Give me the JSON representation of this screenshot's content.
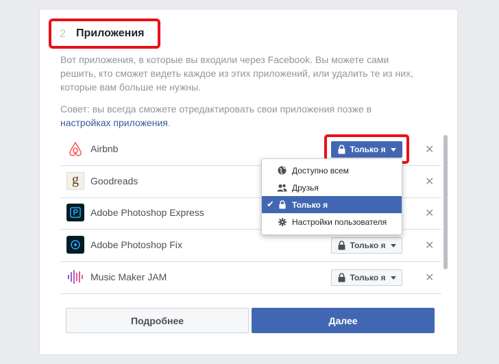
{
  "section": {
    "step": "2",
    "title": "Приложения",
    "description": "Вот приложения, в которые вы входили через Facebook. Вы можете сами решить, кто сможет видеть каждое из этих приложений, или удалить те из них, которые вам больше не нужны.",
    "tip_prefix": "Совет: вы всегда сможете отредактировать свои приложения позже в ",
    "tip_link": "настройках приложения",
    "tip_suffix": "."
  },
  "apps": [
    {
      "name": "Airbnb",
      "privacy": "Только я",
      "icon": "airbnb-logo"
    },
    {
      "name": "Goodreads",
      "privacy": "Только я",
      "icon": "goodreads-logo"
    },
    {
      "name": "Adobe Photoshop Express",
      "privacy": "Только я",
      "icon": "photoshop-express-logo"
    },
    {
      "name": "Adobe Photoshop Fix",
      "privacy": "Только я",
      "icon": "photoshop-fix-logo"
    },
    {
      "name": "Music Maker JAM",
      "privacy": "Только я",
      "icon": "music-maker-jam-logo"
    }
  ],
  "remove_glyph": "✕",
  "dropdown": {
    "options": [
      {
        "label": "Доступно всем",
        "icon": "globe-icon"
      },
      {
        "label": "Друзья",
        "icon": "friends-icon"
      },
      {
        "label": "Только я",
        "icon": "lock-icon",
        "selected": true
      },
      {
        "label": "Настройки пользователя",
        "icon": "gear-icon"
      }
    ]
  },
  "buttons": {
    "more": "Подробнее",
    "next": "Далее"
  },
  "colors": {
    "accent": "#4267b2",
    "highlight": "#e8101a",
    "link": "#365899"
  }
}
